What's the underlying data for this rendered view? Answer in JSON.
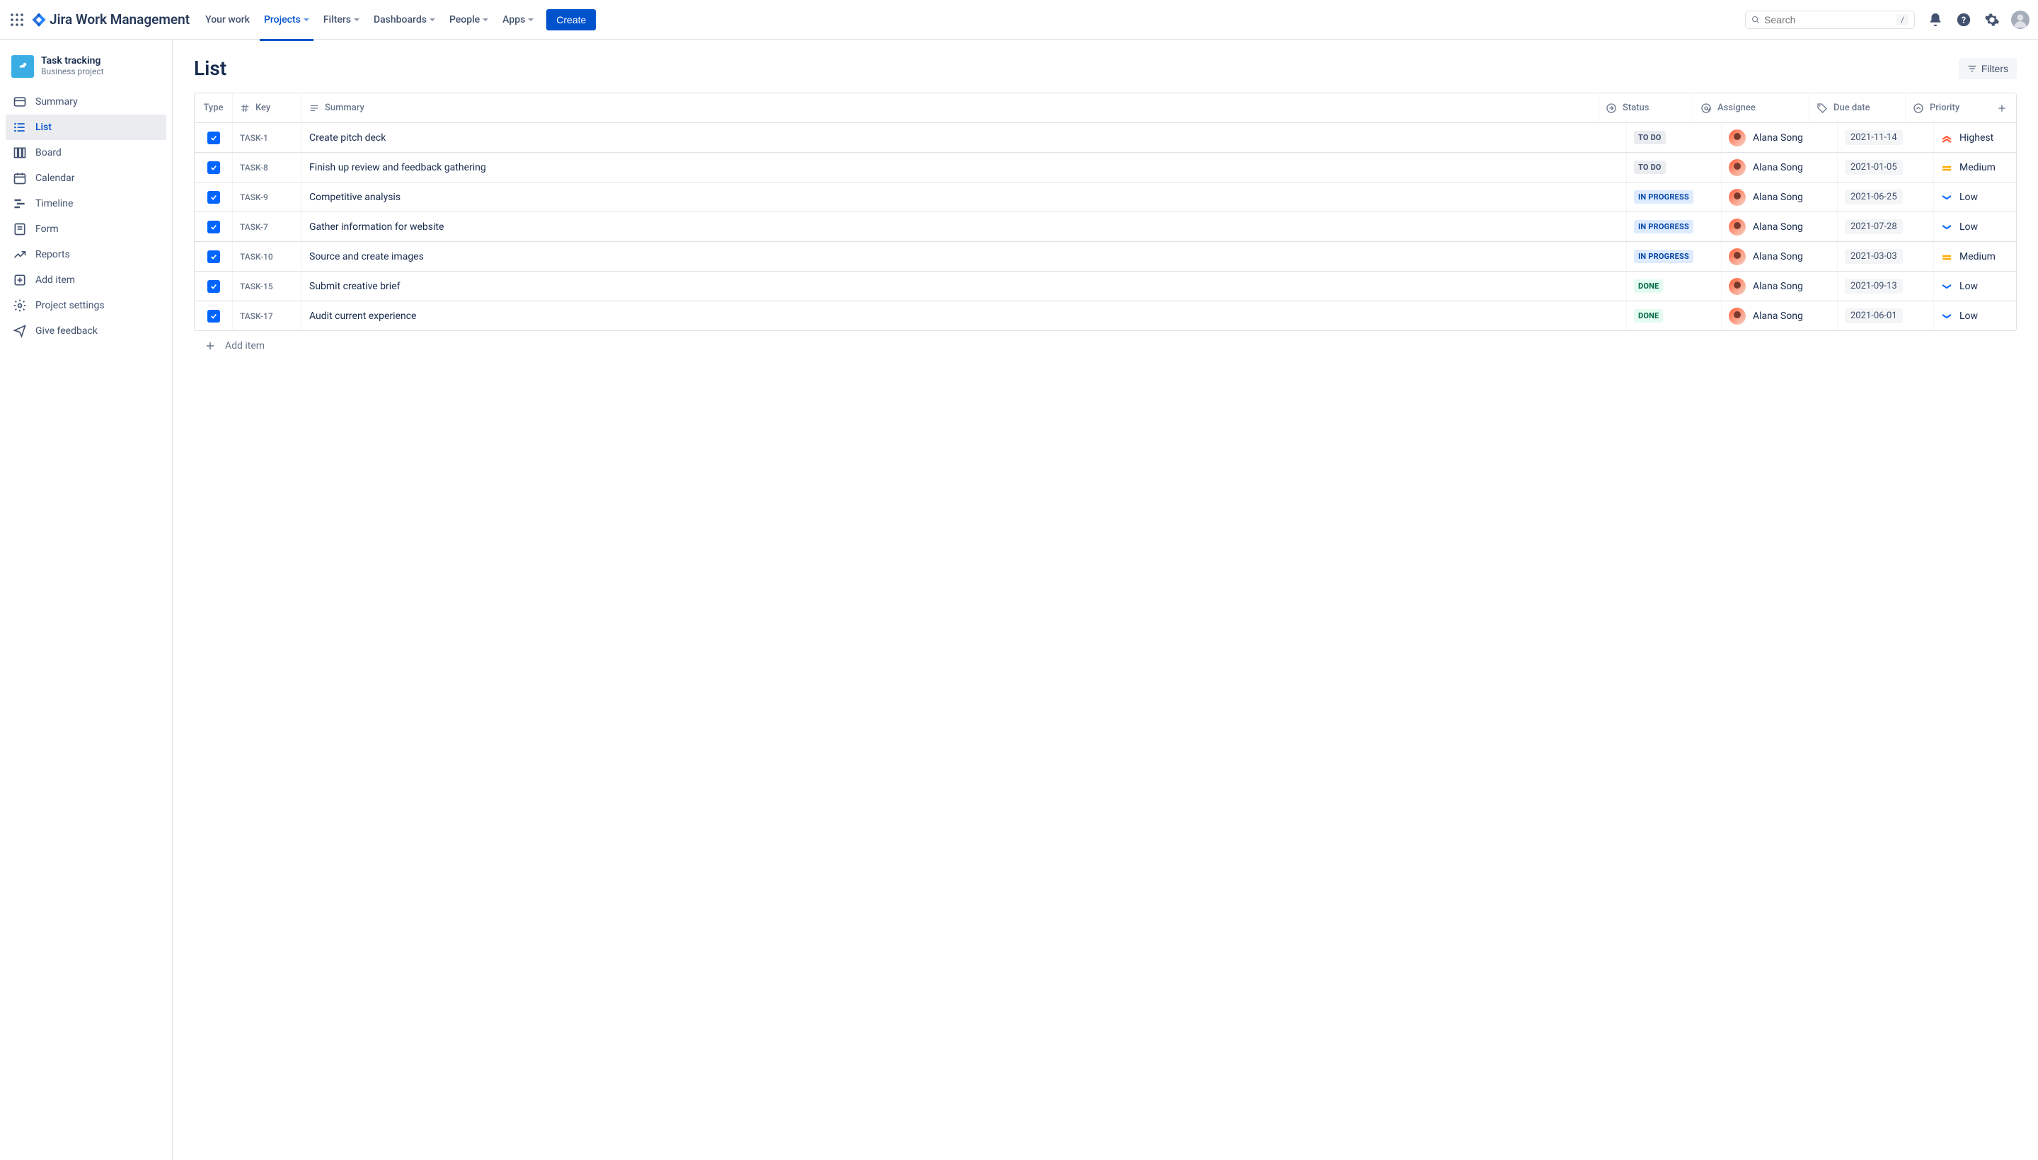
{
  "topbar": {
    "product": "Jira Work Management",
    "nav": [
      "Your work",
      "Projects",
      "Filters",
      "Dashboards",
      "People",
      "Apps"
    ],
    "active_nav_index": 1,
    "create_label": "Create",
    "search_placeholder": "Search",
    "search_kbd": "/"
  },
  "sidebar": {
    "project_name": "Task tracking",
    "project_type": "Business project",
    "items": [
      "Summary",
      "List",
      "Board",
      "Calendar",
      "Timeline",
      "Form",
      "Reports",
      "Add item",
      "Project settings",
      "Give feedback"
    ],
    "selected_index": 1
  },
  "page": {
    "title": "List",
    "filters_label": "Filters",
    "add_item_label": "Add item"
  },
  "table": {
    "columns": [
      "Type",
      "Key",
      "Summary",
      "Status",
      "Assignee",
      "Due date",
      "Priority"
    ],
    "rows": [
      {
        "key": "TASK-1",
        "summary": "Create pitch deck",
        "status": "TO DO",
        "status_class": "todo",
        "assignee": "Alana Song",
        "due": "2021-11-14",
        "priority": "Highest",
        "priority_type": "highest"
      },
      {
        "key": "TASK-8",
        "summary": "Finish up review and feedback gathering",
        "status": "TO DO",
        "status_class": "todo",
        "assignee": "Alana Song",
        "due": "2021-01-05",
        "priority": "Medium",
        "priority_type": "medium"
      },
      {
        "key": "TASK-9",
        "summary": "Competitive analysis",
        "status": "IN PROGRESS",
        "status_class": "inprogress",
        "assignee": "Alana Song",
        "due": "2021-06-25",
        "priority": "Low",
        "priority_type": "low"
      },
      {
        "key": "TASK-7",
        "summary": "Gather information for website",
        "status": "IN PROGRESS",
        "status_class": "inprogress",
        "assignee": "Alana Song",
        "due": "2021-07-28",
        "priority": "Low",
        "priority_type": "low"
      },
      {
        "key": "TASK-10",
        "summary": "Source and create images",
        "status": "IN PROGRESS",
        "status_class": "inprogress",
        "assignee": "Alana Song",
        "due": "2021-03-03",
        "priority": "Medium",
        "priority_type": "medium"
      },
      {
        "key": "TASK-15",
        "summary": "Submit creative brief",
        "status": "DONE",
        "status_class": "done",
        "assignee": "Alana Song",
        "due": "2021-09-13",
        "priority": "Low",
        "priority_type": "low"
      },
      {
        "key": "TASK-17",
        "summary": "Audit current experience",
        "status": "DONE",
        "status_class": "done",
        "assignee": "Alana Song",
        "due": "2021-06-01",
        "priority": "Low",
        "priority_type": "low"
      }
    ]
  }
}
